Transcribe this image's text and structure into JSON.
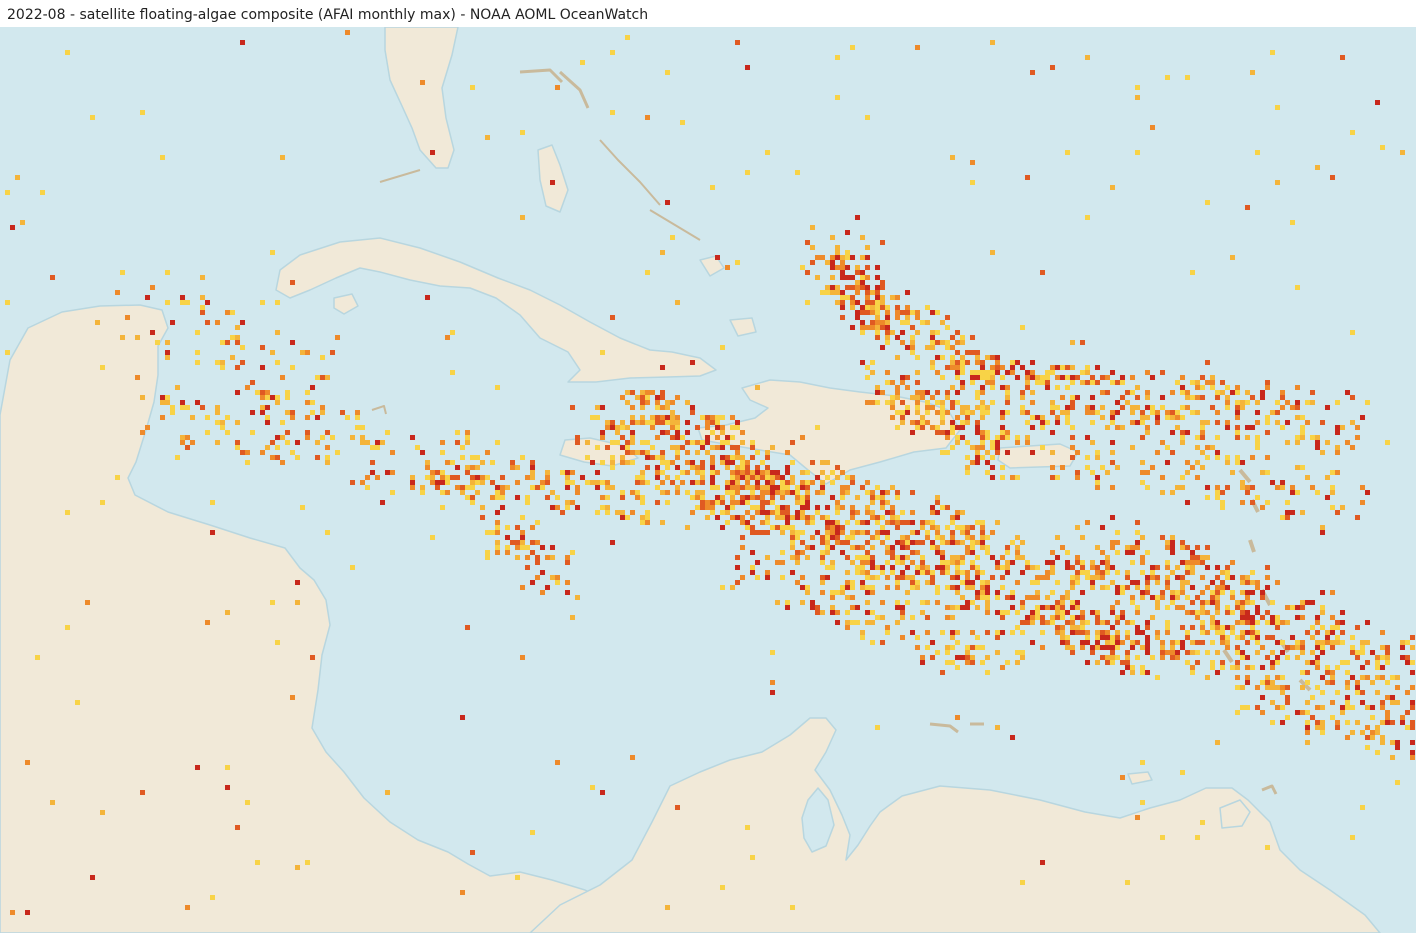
{
  "header": {
    "title": "2022-08 - satellite floating-algae composite (AFAI monthly max) - NOAA AOML OceanWatch"
  },
  "map": {
    "ocean_color": "#d2e8ee",
    "land_color": "#f1e9d8",
    "shore_color": "#b8d6df",
    "density_colors": [
      "#f8d347",
      "#f4b43a",
      "#ee8a2a",
      "#e05a22",
      "#c8281c"
    ]
  }
}
